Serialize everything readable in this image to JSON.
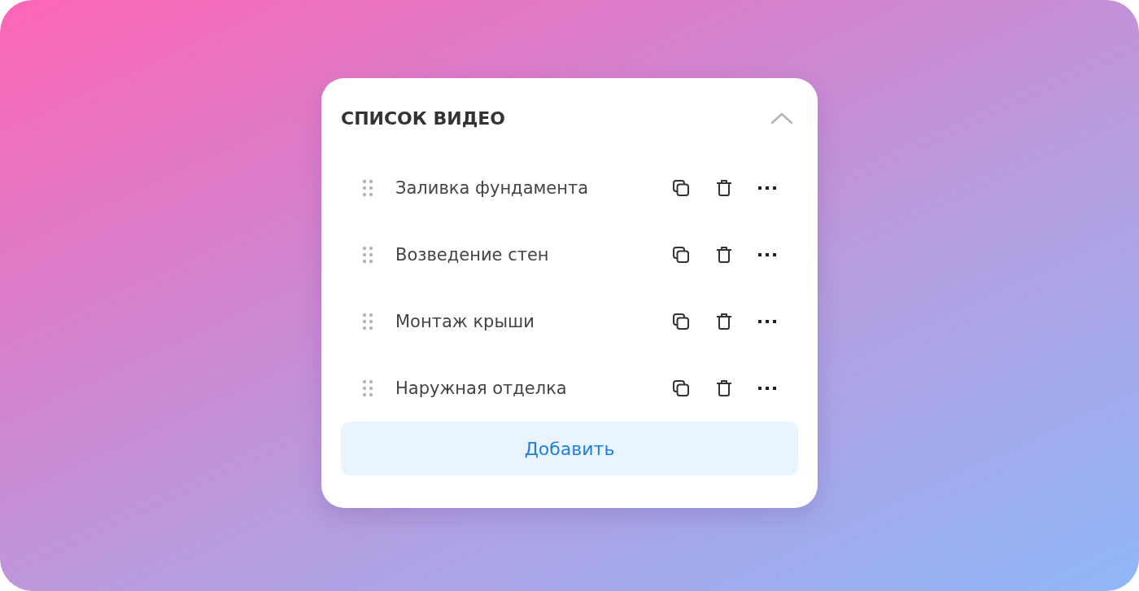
{
  "panel": {
    "title": "СПИСОК ВИДЕО",
    "expanded": true
  },
  "videos": [
    {
      "title": "Заливка фундамента"
    },
    {
      "title": "Возведение стен"
    },
    {
      "title": "Монтаж крыши"
    },
    {
      "title": "Наружная отделка"
    }
  ],
  "add_button": {
    "label": "Добавить"
  }
}
